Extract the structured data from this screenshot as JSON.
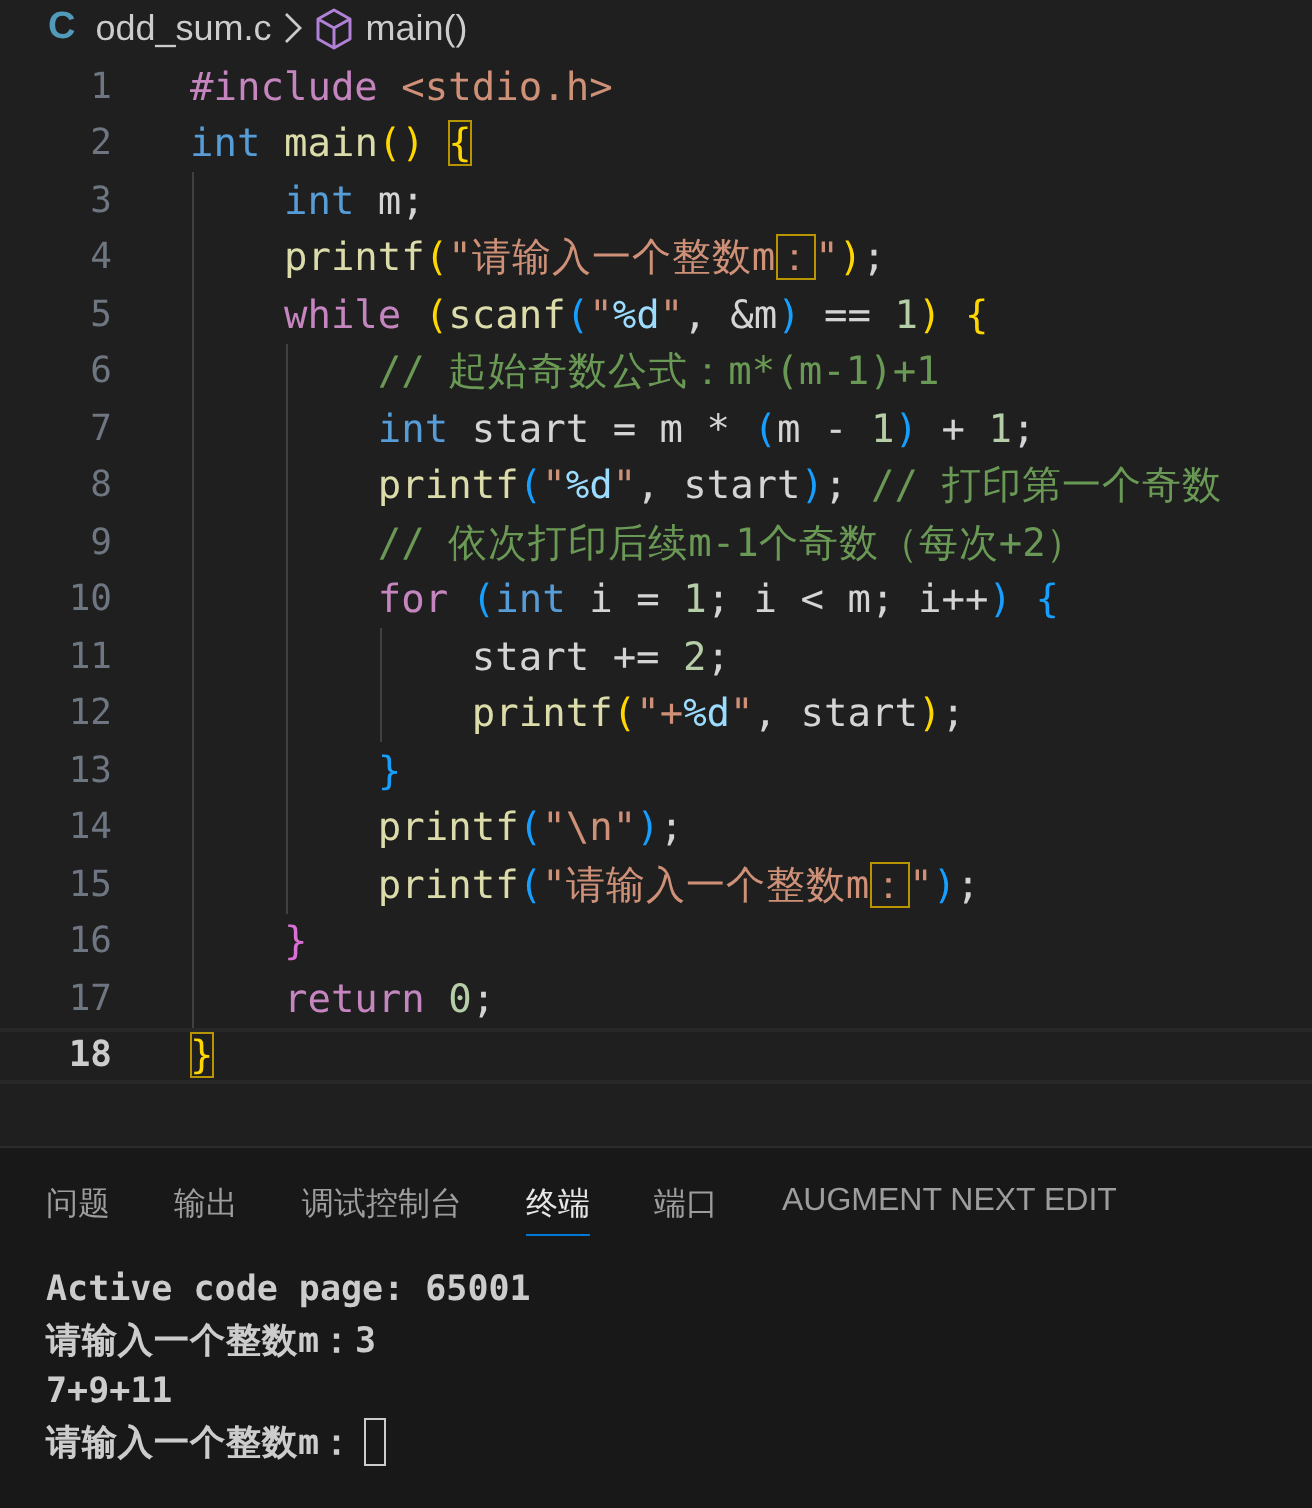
{
  "breadcrumb": {
    "file_icon": "C",
    "file": "odd_sum.c",
    "symbol": "main()"
  },
  "editor": {
    "lines": [
      {
        "number": "1",
        "current": false,
        "tokens": [
          {
            "text": "#include",
            "kind": "keyword"
          },
          {
            "text": " <stdio.h>",
            "kind": "string"
          }
        ]
      },
      {
        "number": "2",
        "current": false,
        "tokens": [
          {
            "text": "int",
            "kind": "type"
          },
          {
            "text": " main",
            "kind": "func"
          },
          {
            "text": "() ",
            "kind": "paren"
          },
          {
            "text": "{",
            "kind": "matchbrace"
          }
        ]
      },
      {
        "number": "3",
        "current": false,
        "tokens": [
          {
            "text": "    int",
            "kind": "type"
          },
          {
            "text": " m;",
            "kind": "plain"
          }
        ]
      },
      {
        "number": "4",
        "current": false,
        "tokens": [
          {
            "text": "    printf",
            "kind": "func"
          },
          {
            "text": "(",
            "kind": "paren"
          },
          {
            "text": "\"请输入一个整数m",
            "kind": "string"
          },
          {
            "text": "：",
            "kind": "matchstr"
          },
          {
            "text": "\"",
            "kind": "string"
          },
          {
            "text": ")",
            "kind": "paren"
          },
          {
            "text": ";",
            "kind": "plain"
          }
        ]
      },
      {
        "number": "5",
        "current": false,
        "tokens": [
          {
            "text": "    while ",
            "kind": "keyword"
          },
          {
            "text": "(",
            "kind": "paren"
          },
          {
            "text": "scanf",
            "kind": "func"
          },
          {
            "text": "(",
            "kind": "brace"
          },
          {
            "text": "\"",
            "kind": "string"
          },
          {
            "text": "%d",
            "kind": "escape"
          },
          {
            "text": "\"",
            "kind": "string"
          },
          {
            "text": ", &m",
            "kind": "plain"
          },
          {
            "text": ")",
            "kind": "brace"
          },
          {
            "text": " == ",
            "kind": "plain"
          },
          {
            "text": "1",
            "kind": "number"
          },
          {
            "text": ") {",
            "kind": "paren"
          }
        ]
      },
      {
        "number": "6",
        "current": false,
        "tokens": [
          {
            "text": "        // 起始奇数公式：m*(m-1)+1",
            "kind": "comment"
          }
        ]
      },
      {
        "number": "7",
        "current": false,
        "tokens": [
          {
            "text": "        int",
            "kind": "type"
          },
          {
            "text": " start = m * ",
            "kind": "plain"
          },
          {
            "text": "(",
            "kind": "brace"
          },
          {
            "text": "m - ",
            "kind": "plain"
          },
          {
            "text": "1",
            "kind": "number"
          },
          {
            "text": ")",
            "kind": "brace"
          },
          {
            "text": " + ",
            "kind": "plain"
          },
          {
            "text": "1",
            "kind": "number"
          },
          {
            "text": ";",
            "kind": "plain"
          }
        ]
      },
      {
        "number": "8",
        "current": false,
        "tokens": [
          {
            "text": "        printf",
            "kind": "func"
          },
          {
            "text": "(",
            "kind": "brace"
          },
          {
            "text": "\"",
            "kind": "string"
          },
          {
            "text": "%d",
            "kind": "escape"
          },
          {
            "text": "\"",
            "kind": "string"
          },
          {
            "text": ", start",
            "kind": "plain"
          },
          {
            "text": ")",
            "kind": "brace"
          },
          {
            "text": "; ",
            "kind": "plain"
          },
          {
            "text": "// 打印第一个奇数",
            "kind": "comment"
          }
        ]
      },
      {
        "number": "9",
        "current": false,
        "tokens": [
          {
            "text": "        // 依次打印后续m-1个奇数（每次+2）",
            "kind": "comment"
          }
        ]
      },
      {
        "number": "10",
        "current": false,
        "tokens": [
          {
            "text": "        for ",
            "kind": "keyword"
          },
          {
            "text": "(",
            "kind": "brace"
          },
          {
            "text": "int",
            "kind": "type"
          },
          {
            "text": " i = ",
            "kind": "plain"
          },
          {
            "text": "1",
            "kind": "number"
          },
          {
            "text": "; i < m; i++",
            "kind": "plain"
          },
          {
            "text": ") {",
            "kind": "brace"
          }
        ]
      },
      {
        "number": "11",
        "current": false,
        "tokens": [
          {
            "text": "            start += ",
            "kind": "plain"
          },
          {
            "text": "2",
            "kind": "number"
          },
          {
            "text": ";",
            "kind": "plain"
          }
        ]
      },
      {
        "number": "12",
        "current": false,
        "tokens": [
          {
            "text": "            printf",
            "kind": "func"
          },
          {
            "text": "(",
            "kind": "paren"
          },
          {
            "text": "\"+",
            "kind": "string"
          },
          {
            "text": "%d",
            "kind": "escape"
          },
          {
            "text": "\"",
            "kind": "string"
          },
          {
            "text": ", start",
            "kind": "plain"
          },
          {
            "text": ")",
            "kind": "paren"
          },
          {
            "text": ";",
            "kind": "plain"
          }
        ]
      },
      {
        "number": "13",
        "current": false,
        "tokens": [
          {
            "text": "        }",
            "kind": "brace"
          }
        ]
      },
      {
        "number": "14",
        "current": false,
        "tokens": [
          {
            "text": "        printf",
            "kind": "func"
          },
          {
            "text": "(",
            "kind": "brace"
          },
          {
            "text": "\"\\n\"",
            "kind": "string"
          },
          {
            "text": ")",
            "kind": "brace"
          },
          {
            "text": ";",
            "kind": "plain"
          }
        ]
      },
      {
        "number": "15",
        "current": false,
        "tokens": [
          {
            "text": "        printf",
            "kind": "func"
          },
          {
            "text": "(",
            "kind": "brace"
          },
          {
            "text": "\"请输入一个整数m",
            "kind": "string"
          },
          {
            "text": "：",
            "kind": "matchstr"
          },
          {
            "text": "\"",
            "kind": "string"
          },
          {
            "text": ")",
            "kind": "brace"
          },
          {
            "text": ";",
            "kind": "plain"
          }
        ]
      },
      {
        "number": "16",
        "current": false,
        "tokens": [
          {
            "text": "    }",
            "kind": "pink"
          }
        ]
      },
      {
        "number": "17",
        "current": false,
        "tokens": [
          {
            "text": "    return ",
            "kind": "keyword"
          },
          {
            "text": "0",
            "kind": "number"
          },
          {
            "text": ";",
            "kind": "plain"
          }
        ]
      },
      {
        "number": "18",
        "current": true,
        "tokens": [
          {
            "text": "}",
            "kind": "matchbrace"
          }
        ]
      }
    ]
  },
  "panel": {
    "tabs": [
      {
        "label": "问题",
        "selected": false
      },
      {
        "label": "输出",
        "selected": false
      },
      {
        "label": "调试控制台",
        "selected": false
      },
      {
        "label": "终端",
        "selected": true
      },
      {
        "label": "端口",
        "selected": false
      },
      {
        "label": "AUGMENT NEXT EDIT",
        "selected": false
      }
    ],
    "terminal": {
      "lines": [
        "Active code page: 65001",
        "请输入一个整数m：3",
        "7+9+11",
        "请输入一个整数m："
      ],
      "cursor": true
    }
  }
}
